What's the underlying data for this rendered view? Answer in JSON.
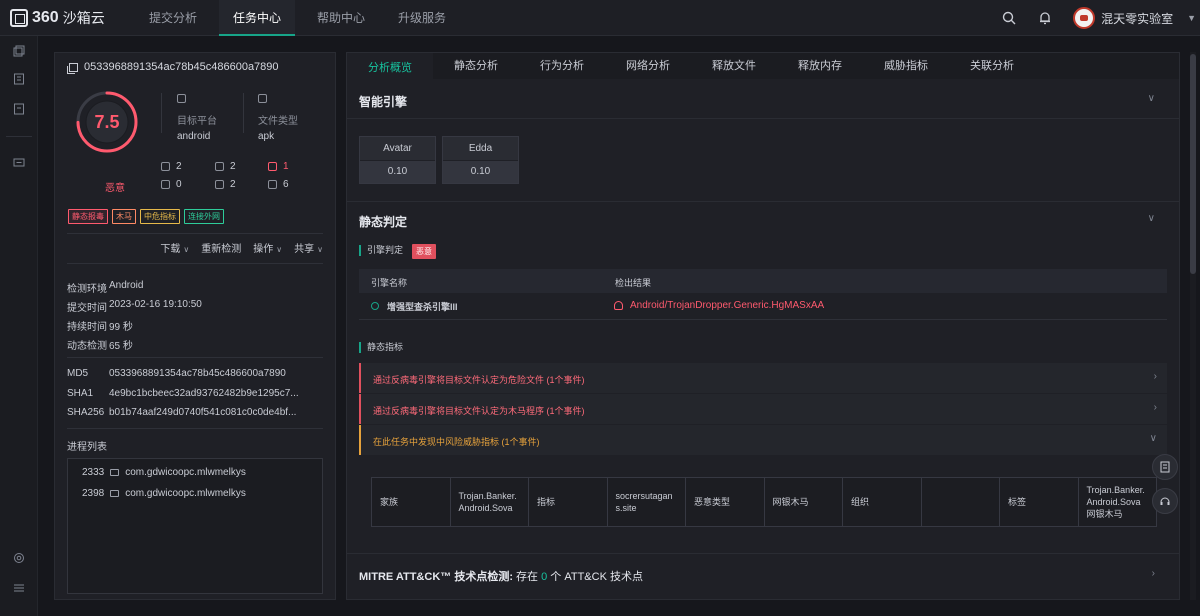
{
  "header": {
    "logo_text": "360",
    "logo_sub": "沙箱云",
    "nav": [
      "提交分析",
      "任务中心",
      "帮助中心",
      "升级服务"
    ],
    "active_nav": "任务中心",
    "user_name": "混天零实验室"
  },
  "sample": {
    "hash": "0533968891354ac78b45c486600a7890",
    "score": "7.5",
    "verdict": "恶意",
    "platform_label": "目标平台",
    "platform_value": "android",
    "filetype_label": "文件类型",
    "filetype_value": "apk",
    "stats": [
      "2",
      "2",
      "1",
      "0",
      "2",
      "6"
    ],
    "tags": [
      "静态报毒",
      "木马",
      "中危指标",
      "连接外网"
    ],
    "actions": [
      "下载",
      "重新检测",
      "操作",
      "共享"
    ],
    "env_label": "检测环境",
    "env_value": "Android",
    "submit_label": "提交时间",
    "submit_value": "2023-02-16 19:10:50",
    "duration_label": "持续时间",
    "duration_value": "99 秒",
    "dynamic_label": "动态检测",
    "dynamic_value": "65 秒",
    "md5_label": "MD5",
    "md5_value": "0533968891354ac78b45c486600a7890",
    "sha1_label": "SHA1",
    "sha1_value": "4e9bc1bcbeec32ad93762482b9e1295c7...",
    "sha256_label": "SHA256",
    "sha256_value": "b01b74aaf249d0740f541c081c0c0de4bf...",
    "process_title": "进程列表",
    "processes": [
      {
        "pid": "2333",
        "name": "com.gdwicoopc.mlwmelkys"
      },
      {
        "pid": "2398",
        "name": "com.gdwicoopc.mlwmelkys"
      }
    ]
  },
  "tabs": [
    "分析概览",
    "静态分析",
    "行为分析",
    "网络分析",
    "释放文件",
    "释放内存",
    "威胁指标",
    "关联分析"
  ],
  "active_tab": "分析概览",
  "smart_engine": {
    "title": "智能引擎",
    "engines": [
      {
        "name": "Avatar",
        "value": "0.10"
      },
      {
        "name": "Edda",
        "value": "0.10"
      }
    ]
  },
  "static_verdict": {
    "title": "静态判定",
    "engine_verdict_label": "引擎判定",
    "engine_verdict_badge": "恶意",
    "col_engine": "引擎名称",
    "col_result": "检出结果",
    "engine_name": "增强型查杀引擎III",
    "engine_result": "Android/TrojanDropper.Generic.HgMASxAA",
    "indicators_label": "静态指标",
    "indicators": [
      {
        "text": "通过反病毒引擎将目标文件认定为危险文件 (1个事件)",
        "level": "red"
      },
      {
        "text": "通过反病毒引擎将目标文件认定为木马程序 (1个事件)",
        "level": "red"
      },
      {
        "text": "在此任务中发现中风险威胁指标 (1个事件)",
        "level": "yellow"
      }
    ],
    "ioc_grid": [
      "家族",
      "Trojan.Banker.Android.Sova",
      "指标",
      "socrersutagans.site",
      "恶意类型",
      "网银木马",
      "组织",
      "",
      "标签",
      "Trojan.Banker.Android.Sova 网银木马"
    ]
  },
  "mitre": {
    "prefix": "MITRE ATT&CK™ 技术点检测:",
    "middle": "存在",
    "count": "0",
    "suffix": "个 ATT&CK 技术点"
  },
  "colors": {
    "accent": "#17a589",
    "danger": "#ff5a6e",
    "warning": "#e6a23c"
  }
}
